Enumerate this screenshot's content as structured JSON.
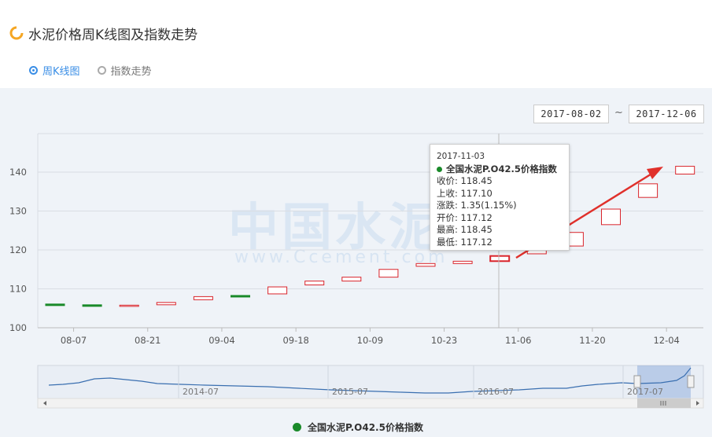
{
  "page": {
    "title": "水泥价格周K线图及指数走势",
    "tabs": [
      {
        "label": "周K线图",
        "active": true
      },
      {
        "label": "指数走势",
        "active": false
      }
    ],
    "date_from": "2017-08-02",
    "date_separator": "~",
    "date_to": "2017-12-06",
    "watermark": "中国水泥",
    "watermark_url": "www.Ccement.com"
  },
  "tooltip": {
    "date": "2017-11-03",
    "series": "全国水泥P.O42.5价格指数",
    "rows": [
      "收价: 118.45",
      "上收: 117.10",
      "涨跌: 1.35(1.15%)",
      "开价: 117.12",
      "最高: 118.45",
      "最低: 117.12"
    ]
  },
  "colors": {
    "up": "#d9242b",
    "down": "#1a8a2a",
    "accent": "#3a8ee6",
    "arrow": "#e0302b"
  },
  "chart_data": {
    "type": "candlestick",
    "title": "",
    "series_name": "全国水泥P.O42.5价格指数",
    "ylim": [
      100,
      145
    ],
    "yticks": [
      100,
      110,
      120,
      130,
      140
    ],
    "xtick_labels": [
      "08-07",
      "08-21",
      "09-04",
      "09-18",
      "10-09",
      "10-23",
      "11-06",
      "11-20",
      "12-04"
    ],
    "candles": [
      {
        "open": 106.1,
        "close": 106.0,
        "dir": "down"
      },
      {
        "open": 105.9,
        "close": 105.8,
        "dir": "down"
      },
      {
        "open": 105.7,
        "close": 105.8,
        "dir": "up"
      },
      {
        "open": 105.9,
        "close": 106.5,
        "dir": "up"
      },
      {
        "open": 107.2,
        "close": 108.0,
        "dir": "up"
      },
      {
        "open": 108.3,
        "close": 108.2,
        "dir": "down"
      },
      {
        "open": 108.7,
        "close": 110.5,
        "dir": "up"
      },
      {
        "open": 111.0,
        "close": 112.0,
        "dir": "up"
      },
      {
        "open": 112.0,
        "close": 113.0,
        "dir": "up"
      },
      {
        "open": 113.0,
        "close": 115.0,
        "dir": "up"
      },
      {
        "open": 115.8,
        "close": 116.5,
        "dir": "up"
      },
      {
        "open": 116.5,
        "close": 117.1,
        "dir": "up"
      },
      {
        "open": 117.12,
        "close": 118.45,
        "dir": "up"
      },
      {
        "open": 119.0,
        "close": 120.0,
        "dir": "up"
      },
      {
        "open": 121.0,
        "close": 124.5,
        "dir": "up"
      },
      {
        "open": 126.5,
        "close": 130.5,
        "dir": "up"
      },
      {
        "open": 133.5,
        "close": 137.0,
        "dir": "up"
      },
      {
        "open": 139.5,
        "close": 141.5,
        "dir": "up"
      }
    ],
    "hovered_index": 12,
    "navigator": {
      "labels": [
        "2014-07",
        "2015-07",
        "2016-07",
        "2017-07"
      ]
    }
  },
  "legend": {
    "label": "全国水泥P.O42.5价格指数"
  }
}
